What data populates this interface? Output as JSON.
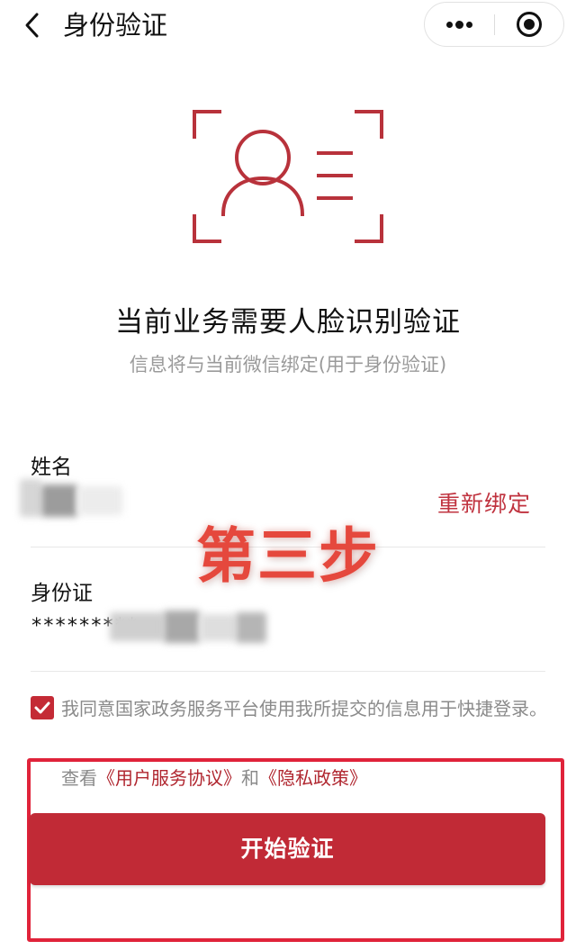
{
  "header": {
    "title": "身份验证",
    "back_icon": "chevron-left-icon",
    "more_icon": "more-dots-icon",
    "close_icon": "target-close-icon"
  },
  "hero": {
    "icon": "face-scan-icon",
    "title": "当前业务需要人脸识别验证",
    "subtitle": "信息将与当前微信绑定(用于身份验证)"
  },
  "form": {
    "name_label": "姓名",
    "name_value_masked": true,
    "rebind_label": "重新绑定",
    "id_label": "身份证",
    "id_value_visible": "*********"
  },
  "overlay": {
    "step_text": "第三步"
  },
  "agreement": {
    "checked": true,
    "text": "我同意国家政务服务平台使用我所提交的信息用于快捷登录。",
    "view_prefix": "查看",
    "user_agreement": "《用户服务协议》",
    "and": "和",
    "privacy_policy": "《隐私政策》"
  },
  "actions": {
    "start_label": "开始验证"
  },
  "colors": {
    "brand_red": "#c12a36",
    "link_red": "#b0262f",
    "highlight_red": "#e0233a",
    "overlay_red": "#e5483d"
  }
}
